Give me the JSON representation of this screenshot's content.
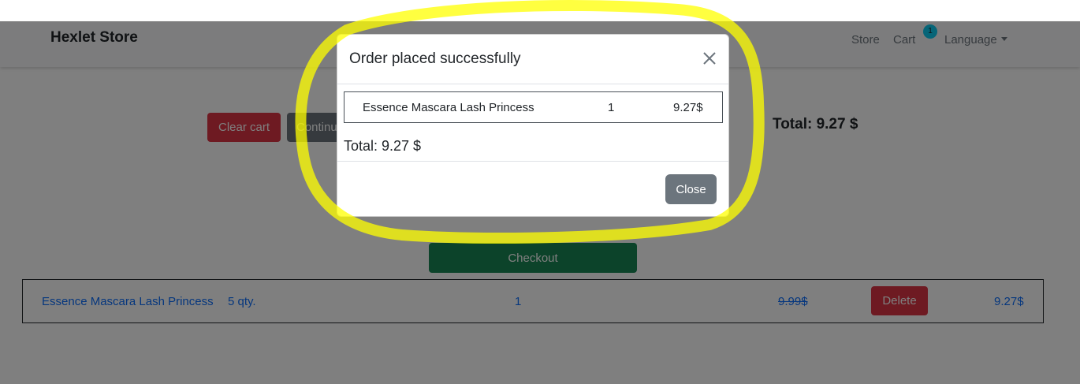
{
  "navbar": {
    "brand": "Hexlet Store",
    "links": {
      "store": "Store",
      "cart": "Cart",
      "cart_count": "1",
      "language": "Language"
    }
  },
  "cart_page": {
    "clear_cart": "Clear cart",
    "continue": "Continue shopping",
    "total": "Total: 9.27 $",
    "checkout": "Checkout",
    "rows": [
      {
        "name": "Essence Mascara Lash Princess",
        "qty_label": "5 qty.",
        "count": "1",
        "old_price": "9.99$",
        "delete": "Delete",
        "final_price": "9.27$"
      }
    ]
  },
  "modal": {
    "title": "Order placed successfully",
    "items": [
      {
        "name": "Essence Mascara Lash Princess",
        "qty": "1",
        "price": "9.27$"
      }
    ],
    "total": "Total: 9.27 $",
    "close_label": "Close"
  },
  "colors": {
    "danger": "#dc3545",
    "secondary": "#6c757d",
    "success": "#198754",
    "link": "#0d6efd",
    "badge": "#0dcaf0",
    "highlight": "#ffff00"
  }
}
